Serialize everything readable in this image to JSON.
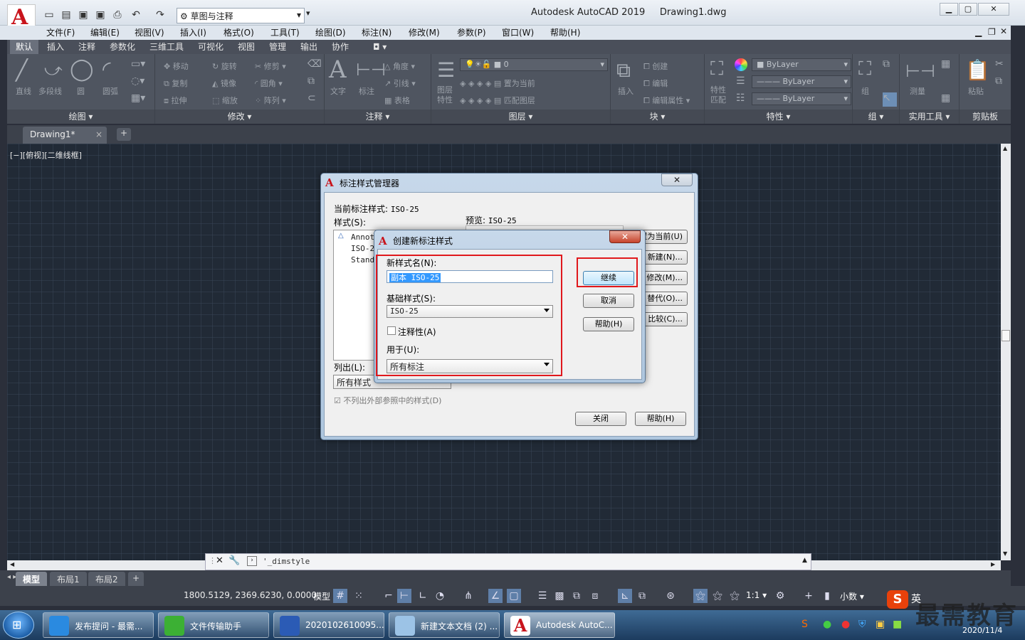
{
  "titlebar": {
    "workspace": "草图与注释",
    "app_title": "Autodesk AutoCAD 2019",
    "file_name": "Drawing1.dwg"
  },
  "menu": [
    "文件(F)",
    "编辑(E)",
    "视图(V)",
    "插入(I)",
    "格式(O)",
    "工具(T)",
    "绘图(D)",
    "标注(N)",
    "修改(M)",
    "参数(P)",
    "窗口(W)",
    "帮助(H)"
  ],
  "ribbon_tabs": [
    "默认",
    "插入",
    "注释",
    "参数化",
    "三维工具",
    "可视化",
    "视图",
    "管理",
    "输出",
    "协作"
  ],
  "ribbon": {
    "draw": {
      "title": "绘图",
      "tools": [
        "直线",
        "多段线",
        "圆",
        "圆弧"
      ]
    },
    "modify": {
      "title": "修改",
      "tools": [
        "移动",
        "旋转",
        "修剪",
        "复制",
        "镜像",
        "圆角",
        "拉伸",
        "缩放",
        "阵列"
      ]
    },
    "annotate": {
      "title": "注释",
      "tools": [
        "文字",
        "标注",
        "线性",
        "引线",
        "表格"
      ],
      "angle": "角度"
    },
    "layers": {
      "title": "图层",
      "current_layer": "0",
      "tools": [
        "置为当前",
        "匹配图层"
      ],
      "props": "图层特性"
    },
    "block": {
      "title": "块",
      "tools": [
        "插入",
        "创建",
        "编辑",
        "编辑属性"
      ]
    },
    "properties": {
      "title": "特性",
      "bylayer": [
        "ByLayer",
        "ByLayer",
        "ByLayer"
      ],
      "match": "特性匹配"
    },
    "groups": {
      "title": "组",
      "tool": "组"
    },
    "utilities": {
      "title": "实用工具",
      "tool": "测量"
    },
    "clipboard": {
      "title": "剪贴板",
      "tool": "粘贴"
    }
  },
  "doc_tab": "Drawing1*",
  "viewport_label": "[−][俯视][二维线框]",
  "command_line": "'_dimstyle",
  "layout_tabs": [
    "模型",
    "布局1",
    "布局2"
  ],
  "status": {
    "coords": "1800.5129, 2369.6230, 0.0000",
    "model": "模型",
    "scale": "1:1",
    "units": "小数"
  },
  "dim_style_manager": {
    "title": "标注样式管理器",
    "current_style_label": "当前标注样式:",
    "current_style_value": "ISO-25",
    "styles_label": "样式(S):",
    "styles": [
      "Annot",
      "ISO-2",
      "Stand"
    ],
    "preview_label": "预览:",
    "preview_value": "ISO-25",
    "buttons": [
      "置为当前(U)",
      "新建(N)...",
      "修改(M)...",
      "替代(O)...",
      "比较(C)..."
    ],
    "list_label": "列出(L):",
    "list_value": "所有样式",
    "exclude_xref": "不列出外部参照中的样式(D)",
    "close": "关闭",
    "help": "帮助(H)"
  },
  "new_style_dialog": {
    "title": "创建新标注样式",
    "new_name_label": "新样式名(N):",
    "new_name_value": "副本 ISO-25",
    "base_label": "基础样式(S):",
    "base_value": "ISO-25",
    "annotative_label": "注释性(A)",
    "use_for_label": "用于(U):",
    "use_for_value": "所有标注",
    "continue": "继续",
    "cancel": "取消",
    "help": "帮助(H)"
  },
  "taskbar": {
    "tasks": [
      "发布提问 - 最需...",
      "文件传输助手",
      "2020102610095...",
      "新建文本文档 (2) ...",
      "Autodesk AutoC..."
    ],
    "time": "2020/11/4",
    "ime": "英"
  },
  "watermark": "最需教育",
  "colors": {
    "highlight_box": "#e0181c",
    "autocad_red": "#c8141c",
    "canvas": "#212a36"
  }
}
